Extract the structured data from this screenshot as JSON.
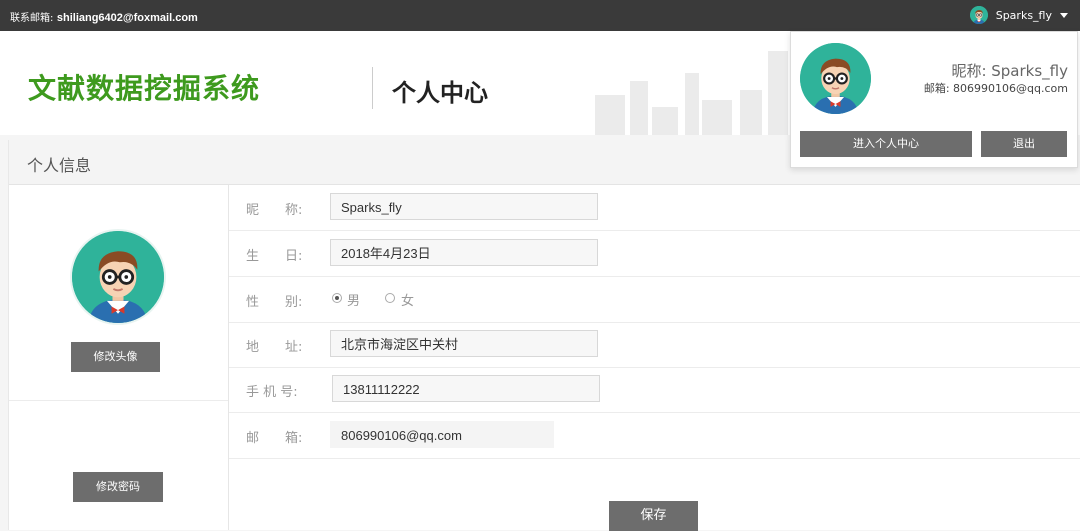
{
  "topbar": {
    "contact_label": "联系邮箱:",
    "contact_email": "shiliang6402@foxmail.com",
    "username": "Sparks_fly"
  },
  "header": {
    "logo_text": "文献数据挖掘系统",
    "page_title": "个人中心"
  },
  "panel": {
    "title": "个人信息",
    "change_avatar_label": "修改头像",
    "change_password_label": "修改密码",
    "save_label": "保存"
  },
  "form": {
    "nickname_label": "昵　　称:",
    "nickname_value": "Sparks_fly",
    "birthday_label": "生　　日:",
    "birthday_value": "2018年4月23日",
    "gender_label": "性　　别:",
    "gender_male": "男",
    "gender_female": "女",
    "gender_selected": "男",
    "address_label": "地　　址:",
    "address_value": "北京市海淀区中关村",
    "phone_label": "手 机 号:",
    "phone_value": "13811112222",
    "email_label": "邮　　箱:",
    "email_value": "806990106@qq.com"
  },
  "popup": {
    "nickname_text": "昵称:  Sparks_fly",
    "email_text": "邮箱: 806990106@qq.com",
    "enter_center_label": "进入个人中心",
    "logout_label": "退出"
  },
  "icons": {
    "avatar": "cartoon-boy-avatar-icon",
    "dropdown": "caret-down-icon"
  },
  "colors": {
    "topbar_bg": "#3a3a3a",
    "logo_green": "#3e9a1e",
    "avatar_teal": "#2fb39a",
    "button_gray": "#6d6d6d"
  }
}
